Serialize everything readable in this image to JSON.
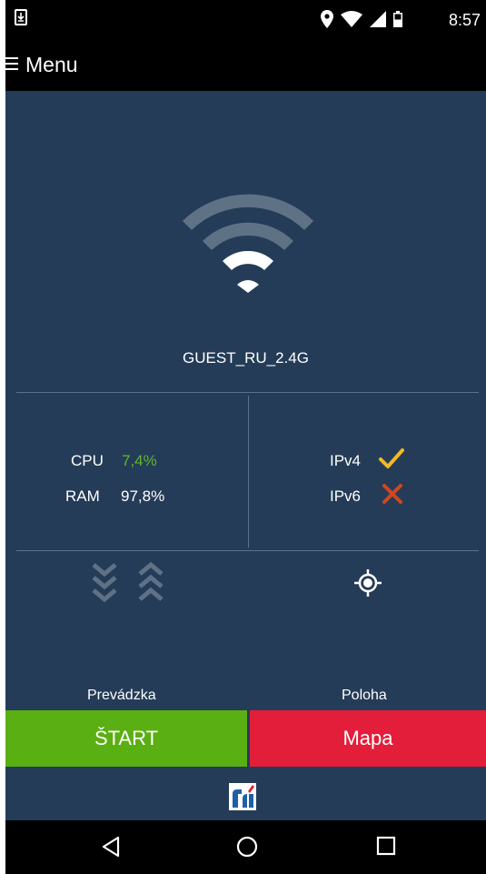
{
  "status_bar": {
    "time": "8:57",
    "icons": [
      "download-icon",
      "location-icon",
      "wifi-signal-icon",
      "cell-signal-icon",
      "battery-icon"
    ]
  },
  "app_bar": {
    "menu_label": "Menu",
    "icon": "hamburger-icon"
  },
  "network": {
    "ssid": "GUEST_RU_2.4G",
    "icon": "wifi-icon"
  },
  "stats": {
    "cpu_label": "CPU",
    "cpu_value": "7,4%",
    "cpu_color": "#5fb82c",
    "ram_label": "RAM",
    "ram_value": "97,8%"
  },
  "ip": {
    "ipv4_label": "IPv4",
    "ipv4_status": "check-icon",
    "ipv4_color": "#f4b823",
    "ipv6_label": "IPv6",
    "ipv6_status": "cross-icon",
    "ipv6_color": "#d2461e"
  },
  "traffic": {
    "caption": "Prevádzka",
    "icons": [
      "download-chevrons-icon",
      "upload-chevrons-icon"
    ]
  },
  "location": {
    "caption": "Poloha",
    "icon": "gps-target-icon"
  },
  "buttons": {
    "start_label": "ŠTART",
    "start_color": "#5aaf12",
    "map_label": "Mapa",
    "map_color": "#e21e3a"
  },
  "footer": {
    "logo": "brand-logo"
  },
  "nav_bar": {
    "icons": [
      "back-icon",
      "home-icon",
      "recents-icon"
    ]
  },
  "colors": {
    "background": "#243c57",
    "bars": "#000000",
    "divider": "#5e7288"
  }
}
